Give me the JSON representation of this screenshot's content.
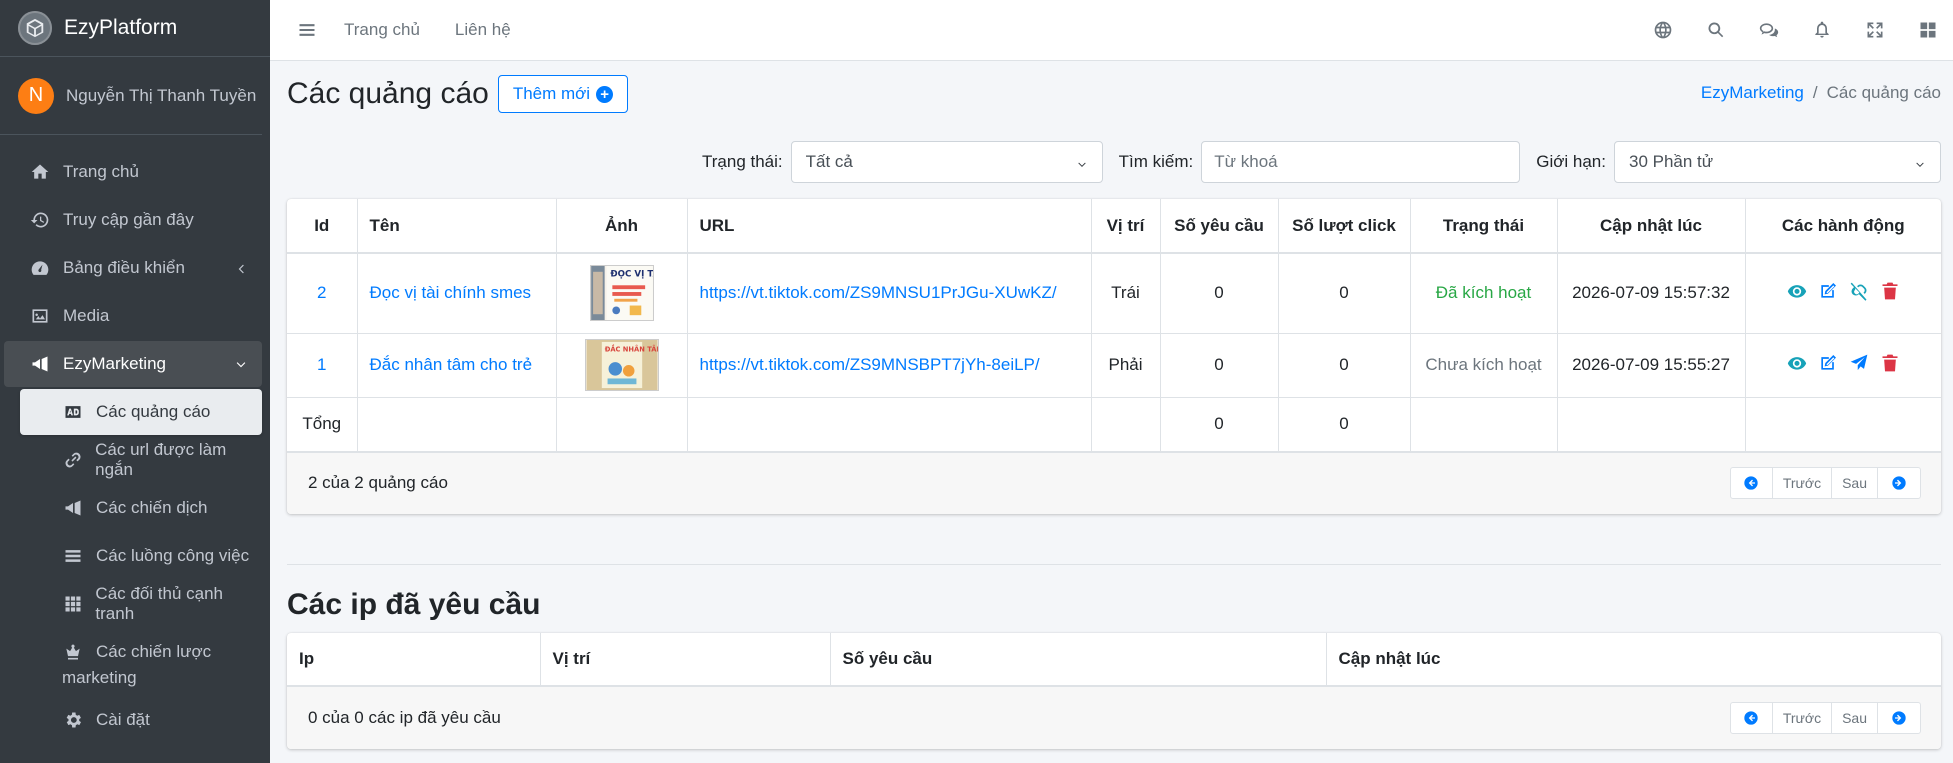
{
  "app": {
    "brand": "EzyPlatform"
  },
  "user": {
    "initial": "N",
    "name": "Nguyễn Thị Thanh Tuyền"
  },
  "sidebar": {
    "items": [
      {
        "label": "Trang chủ",
        "icon": "home-icon"
      },
      {
        "label": "Truy cập gần đây",
        "icon": "history-icon"
      },
      {
        "label": "Bảng điều khiển",
        "icon": "dashboard-icon"
      },
      {
        "label": "Media",
        "icon": "image-icon"
      },
      {
        "label": "EzyMarketing",
        "icon": "megaphone-icon"
      }
    ],
    "subitems": [
      {
        "label": "Các quảng cáo",
        "icon": "ad-icon"
      },
      {
        "label": "Các url được làm ngắn",
        "icon": "link-icon"
      },
      {
        "label": "Các chiến dịch",
        "icon": "megaphone-icon"
      },
      {
        "label": "Các luồng công việc",
        "icon": "bars-icon"
      },
      {
        "label": "Các đối thủ cạnh tranh",
        "icon": "grid-icon"
      },
      {
        "label_line1": "Các chiến lược",
        "label_line2": "marketing",
        "icon": "crown-icon"
      },
      {
        "label": "Cài đặt",
        "icon": "gear-icon"
      }
    ]
  },
  "topbar": {
    "home": "Trang chủ",
    "contact": "Liên hệ"
  },
  "page": {
    "title": "Các quảng cáo",
    "add_label": "Thêm mới",
    "breadcrumb": {
      "parent": "EzyMarketing",
      "current": "Các quảng cáo"
    }
  },
  "filters": {
    "status_label": "Trạng thái:",
    "status_value": "Tất cả",
    "search_label": "Tìm kiếm:",
    "search_placeholder": "Từ khoá",
    "limit_label": "Giới hạn:",
    "limit_value": "30 Phần tử"
  },
  "ads_table": {
    "headers": [
      "Id",
      "Tên",
      "Ảnh",
      "URL",
      "Vị trí",
      "Số yêu cầu",
      "Số lượt click",
      "Trạng thái",
      "Cập nhật lúc",
      "Các hành động"
    ],
    "rows": [
      {
        "id": "2",
        "name": "Đọc vị tài chính smes",
        "url": "https://vt.tiktok.com/ZS9MNSU1PrJGu-XUwKZ/",
        "position": "Trái",
        "requests": "0",
        "clicks": "0",
        "status": "Đã kích hoạt",
        "updated": "2026-07-09 15:57:32",
        "image_caption": "ĐỌC VỊ TÀI CHÍNH SMEs"
      },
      {
        "id": "1",
        "name": "Đắc nhân tâm cho trẻ",
        "url": "https://vt.tiktok.com/ZS9MNSBPT7jYh-8eiLP/",
        "position": "Phải",
        "requests": "0",
        "clicks": "0",
        "status": "Chưa kích hoạt",
        "updated": "2026-07-09 15:55:27",
        "image_caption": "ĐẮC NHÂN TÂM"
      }
    ],
    "total_label": "Tổng",
    "total_requests": "0",
    "total_clicks": "0",
    "footer": "2 của 2 quảng cáo"
  },
  "pager": {
    "prev": "Trước",
    "next": "Sau"
  },
  "ip_section": {
    "title": "Các ip đã yêu cầu",
    "headers": [
      "Ip",
      "Vị trí",
      "Số yêu cầu",
      "Cập nhật lúc"
    ],
    "footer": "0 của 0 các ip đã yêu cầu"
  },
  "colors": {
    "sidebar": "#343a40",
    "accent": "#007bff",
    "success": "#28a745",
    "danger": "#dc3545",
    "info": "#17a2b8"
  }
}
